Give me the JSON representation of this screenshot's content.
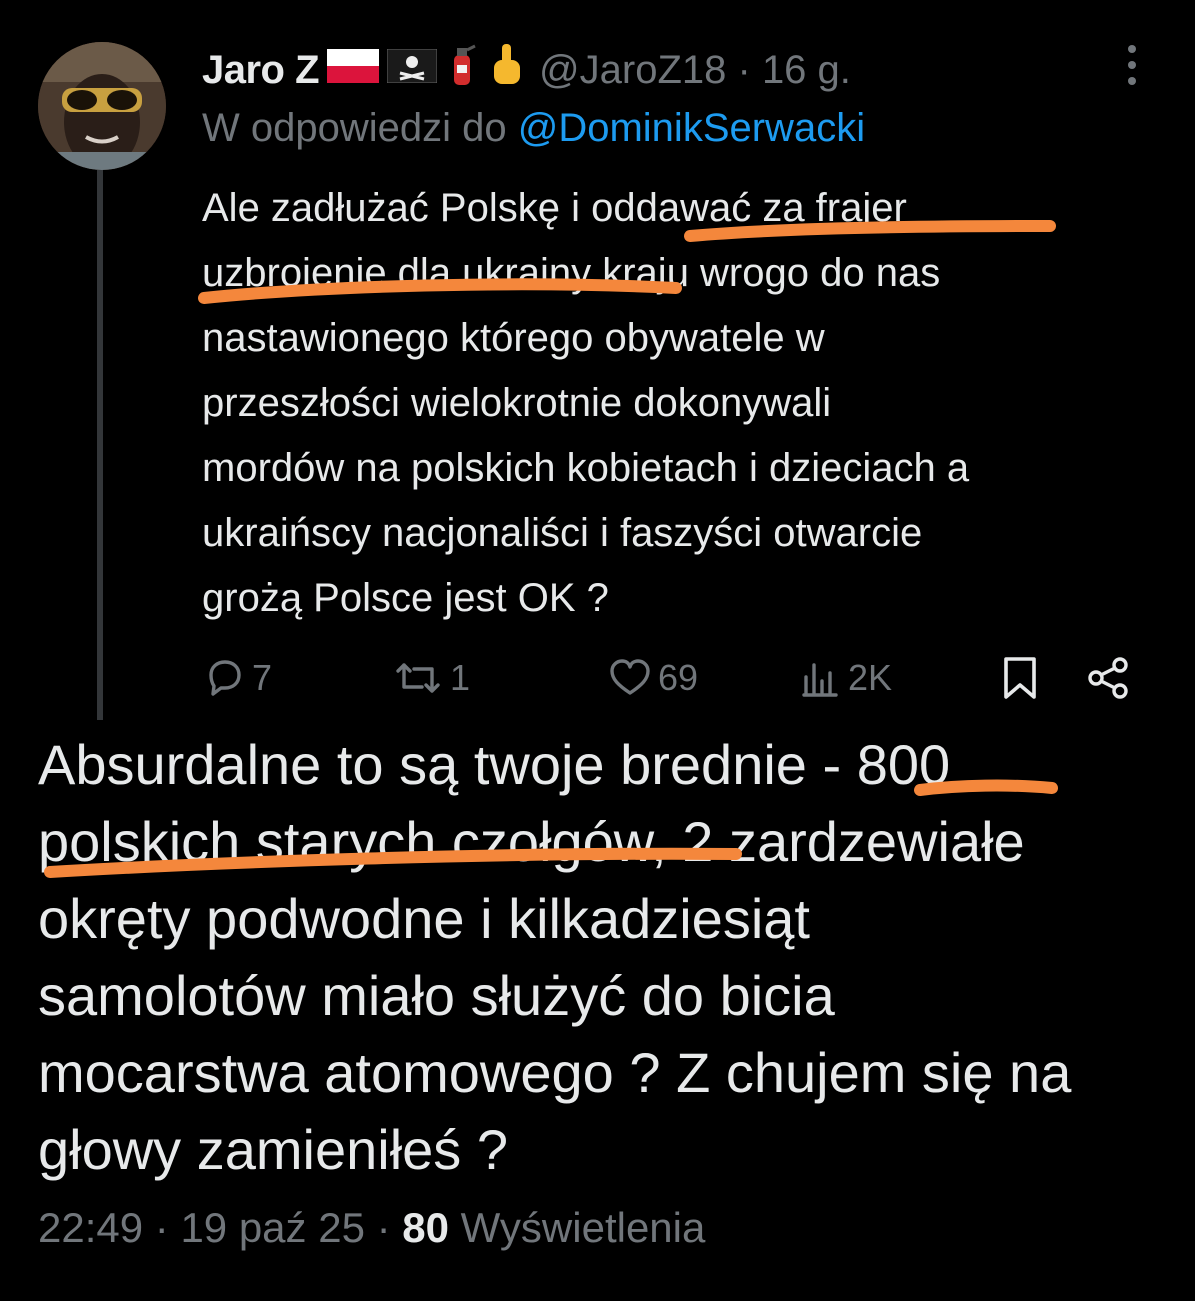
{
  "reply_tweet": {
    "author_name": "Jaro Z",
    "handle": "@JaroZ18",
    "separator": " · ",
    "time_ago": "16 g.",
    "emojis": [
      "poland-flag",
      "pirate-flag",
      "fire-extinguisher",
      "middle-finger"
    ],
    "reply_prefix": "W odpowiedzi do ",
    "reply_mention": "@DominikSerwacki",
    "text": "Ale zadłużać Polskę i oddawać za frajer\nuzbrojenie dla ukrainy kraju wrogo do nas\nnastawionego którego obywatele w\nprzeszłości wielokrotnie dokonywali\nmordów na polskich kobietach i dzieciach a\nukraińscy nacjonaliści i faszyści otwarcie\ngrożą Polsce jest OK ?",
    "actions": {
      "replies": "7",
      "reposts": "1",
      "likes": "69",
      "views": "2K"
    }
  },
  "main_tweet": {
    "text": "Absurdalne to są twoje brednie - 800\npolskich starych czołgów, 2 zardzewiałe\nokręty podwodne i kilkadziesiąt\nsamolotów miało służyć do bicia\nmocarstwa atomowego ? Z chujem się na\ngłowy zamieniłeś ?",
    "time": "22:49",
    "date": "19 paź 25",
    "separator": " · ",
    "views_count": "80",
    "views_label": " Wyświetlenia"
  },
  "colors": {
    "background": "#000000",
    "text": "#e7e9ea",
    "secondary": "#71767b",
    "link": "#1d9bf0",
    "annotation": "#f4873c"
  },
  "icons": [
    "more-icon",
    "reply-icon",
    "repost-icon",
    "like-icon",
    "views-icon",
    "bookmark-icon",
    "share-icon"
  ]
}
